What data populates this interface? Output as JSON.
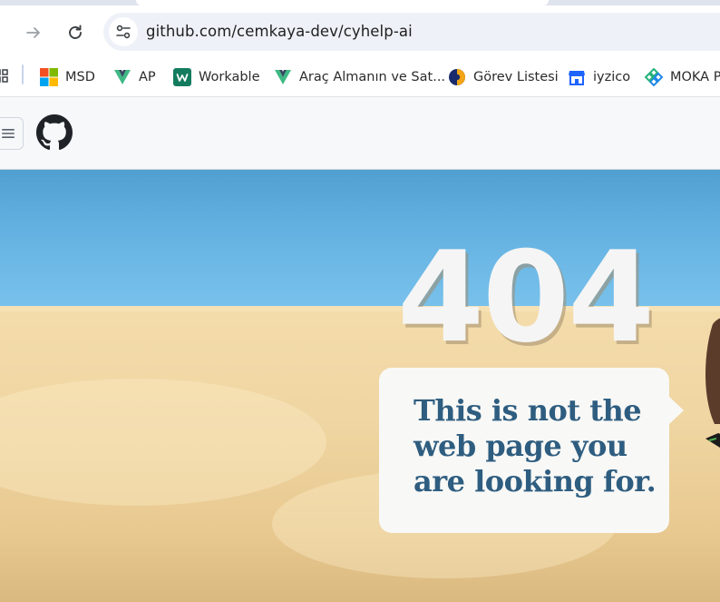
{
  "browser": {
    "url": "github.com/cemkaya-dev/cyhelp-ai",
    "back_icon": "arrow-left-icon",
    "forward_icon": "arrow-right-icon",
    "reload_icon": "reload-icon",
    "site_info_icon": "tune-icon"
  },
  "bookmarks": [
    {
      "label": "MSD",
      "icon": "microsoft-logo-icon"
    },
    {
      "label": "AP",
      "icon": "vue-v-icon"
    },
    {
      "label": "Workable",
      "icon": "workable-icon"
    },
    {
      "label": "Araç Almanın ve Sat...",
      "icon": "vue-v-icon"
    },
    {
      "label": "Görev Listesi",
      "icon": "globe-icon"
    },
    {
      "label": "iyzico",
      "icon": "store-icon"
    },
    {
      "label": "MOKA P",
      "icon": "moka-icon"
    }
  ],
  "github": {
    "menu_icon": "hamburger-icon",
    "logo_icon": "github-logo-icon"
  },
  "error_page": {
    "code": "404",
    "message": "This is not the web page you are looking for."
  },
  "colors": {
    "sky": "#62b0e0",
    "sand": "#efd5a1",
    "message_text": "#2e5d80",
    "bubble": "#f8f8f6"
  }
}
